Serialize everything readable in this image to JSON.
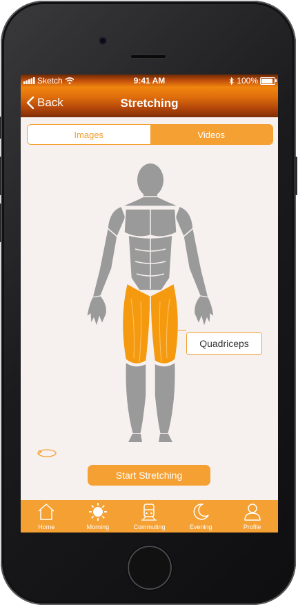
{
  "status_bar": {
    "carrier": "Sketch",
    "time": "9:41 AM",
    "battery": "100%",
    "battery_level": 1.0
  },
  "nav": {
    "back_label": "Back",
    "title": "Stretching"
  },
  "segmented": {
    "images_label": "Images",
    "videos_label": "Videos",
    "selected": "Videos"
  },
  "body_map": {
    "highlighted_muscle": "quadriceps"
  },
  "callout": {
    "label": "Quadriceps"
  },
  "start_button": {
    "label": "Start Stretching"
  },
  "tabs": [
    {
      "label": "Home",
      "icon": "home-icon"
    },
    {
      "label": "Morning",
      "icon": "sun-icon"
    },
    {
      "label": "Commuting",
      "icon": "train-icon"
    },
    {
      "label": "Evening",
      "icon": "moon-icon"
    },
    {
      "label": "Profile",
      "icon": "user-icon"
    }
  ],
  "colors": {
    "accent": "#f5a032",
    "highlight": "#f59a0f",
    "muscle": "#9a9a9a",
    "background": "#f6f1ef"
  }
}
